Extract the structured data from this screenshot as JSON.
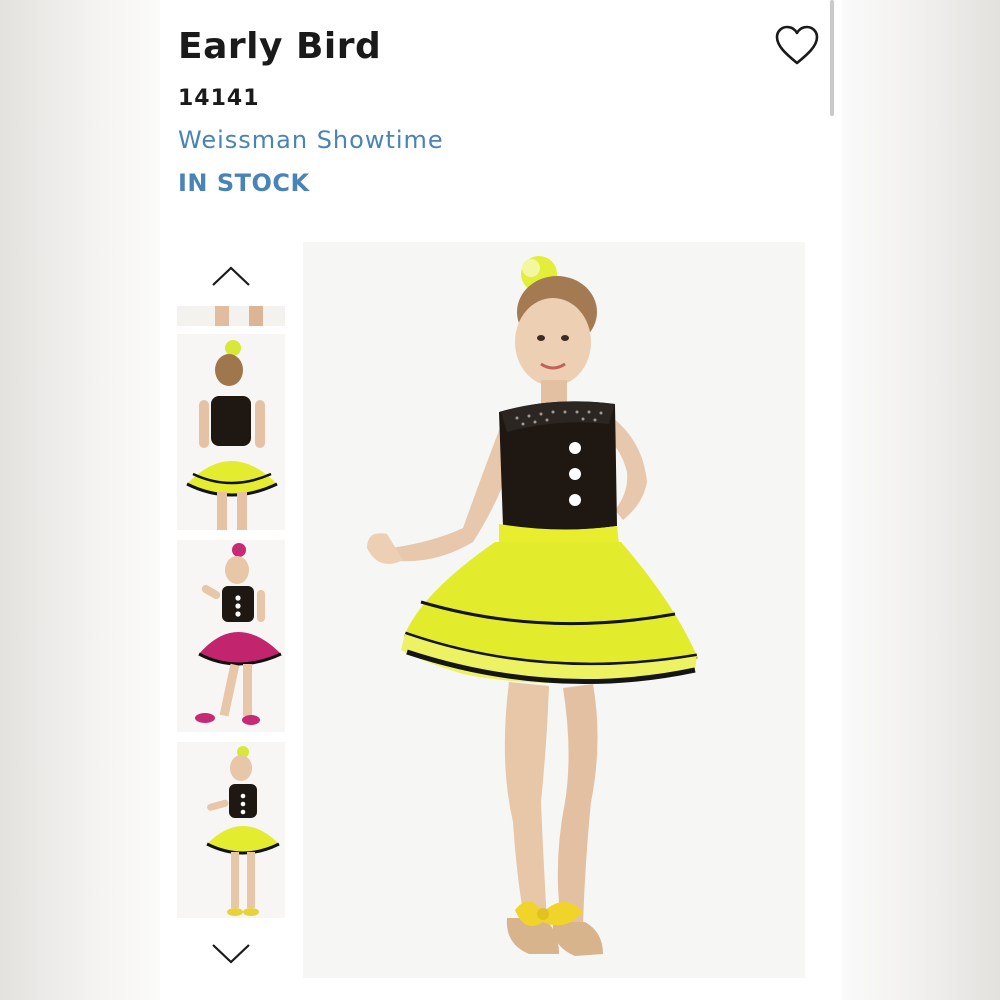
{
  "product": {
    "title": "Early Bird",
    "sku": "14141",
    "brand": "Weissman Showtime",
    "stock_status": "IN STOCK"
  },
  "gallery": {
    "thumbnails": [
      {
        "alt": "Leg detail thumbnail"
      },
      {
        "alt": "Back view, yellow skirt"
      },
      {
        "alt": "Front view, pink skirt"
      },
      {
        "alt": "Front view, yellow skirt"
      }
    ],
    "main_image": {
      "alt": "Early Bird costume with yellow tutu"
    }
  },
  "icons": {
    "favorite": "heart-outline-icon",
    "prev": "chevron-up-icon",
    "next": "chevron-down-icon"
  },
  "colors": {
    "accent": "#4a83b6",
    "title": "#1a1a1a",
    "skirt_yellow": "#e6ee2c",
    "skirt_pink": "#c2246e"
  }
}
